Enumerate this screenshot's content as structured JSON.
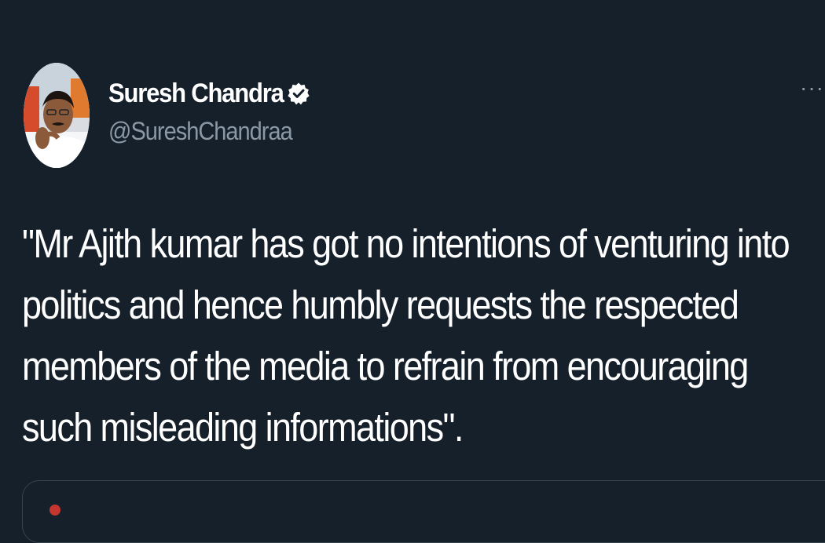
{
  "tweet": {
    "author": {
      "display_name": "Suresh Chandra",
      "handle": "@SureshChandraa",
      "verified": true,
      "avatar_icon": "profile-photo"
    },
    "more_label": "···",
    "text_lines": [
      "\"Mr Ajith kumar has got no intentions of venturing into",
      "politics and hence humbly requests the respected",
      "members of the  media to refrain from encouraging",
      "such misleading informations\"."
    ]
  },
  "colors": {
    "background": "#15202b",
    "primary_text": "#ffffff",
    "secondary_text": "#8b98a5",
    "border": "#38444d"
  }
}
